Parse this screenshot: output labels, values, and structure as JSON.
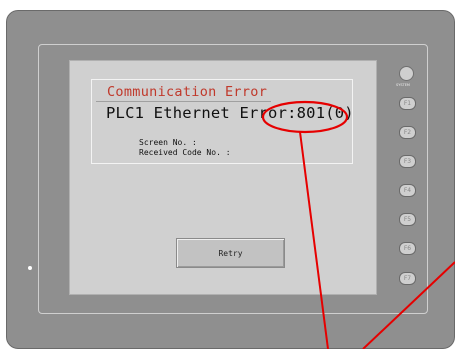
{
  "dialog": {
    "title": "Communication Error",
    "error_message": "PLC1 Ethernet Error:801(0)",
    "screen_no_label": "Screen No. :",
    "received_code_label": "Received Code No. :",
    "retry_label": "Retry"
  },
  "panel_buttons": {
    "system_label": "SYSTEM",
    "function_keys": [
      "F1",
      "F2",
      "F3",
      "F4",
      "F5",
      "F6",
      "F7"
    ]
  },
  "colors": {
    "title_text": "#c0392b",
    "annotation": "#e60000",
    "screen_bg": "#d0d0d0",
    "device_body": "#8f8f8f"
  }
}
